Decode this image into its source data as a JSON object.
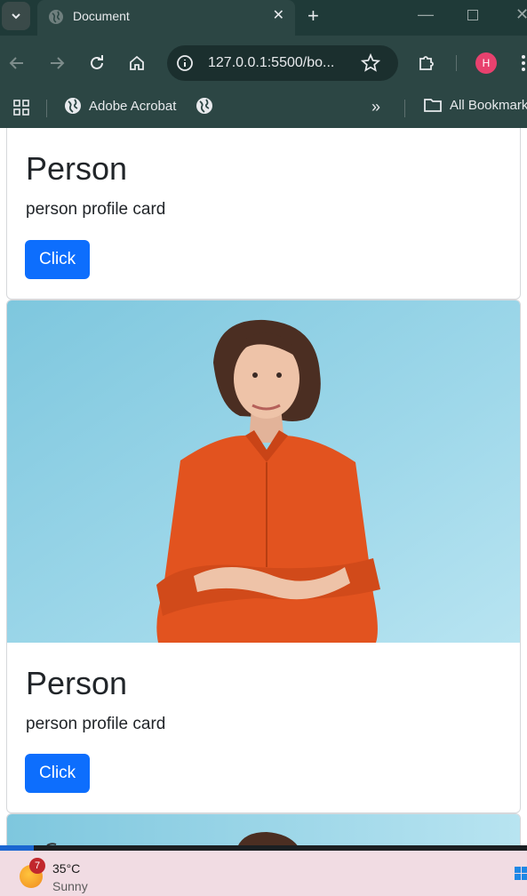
{
  "browser": {
    "tab_title": "Document",
    "url": "127.0.0.1:5500/bo...",
    "profile_initial": "H",
    "bookmarks": [
      {
        "label": "Adobe Acrobat"
      },
      {
        "label": ""
      }
    ],
    "bookmarks_more": "»",
    "all_bookmarks": "All Bookmarks"
  },
  "cards": [
    {
      "title": "Person",
      "text": "person profile card",
      "button": "Click"
    },
    {
      "title": "Person",
      "text": "person profile card",
      "button": "Click"
    },
    {
      "title": "",
      "text": "",
      "button": ""
    }
  ],
  "taskbar": {
    "weather_badge": "7",
    "temperature": "35°C",
    "condition": "Sunny"
  },
  "colors": {
    "chrome": "#2c4644",
    "button": "#0d6efd",
    "photo_background": "#8fd3e8",
    "shirt": "#e2531f"
  }
}
